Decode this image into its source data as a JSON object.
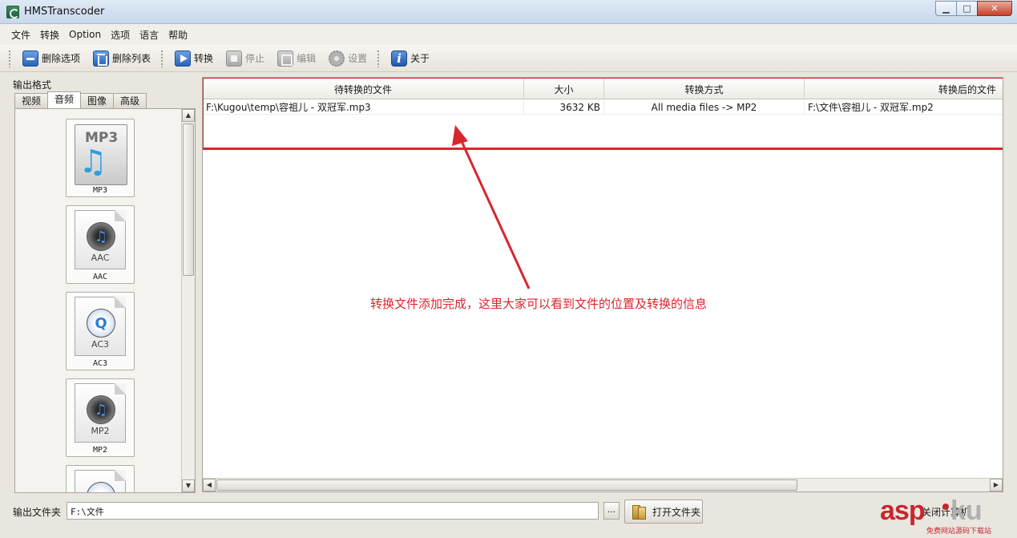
{
  "window": {
    "title": "HMSTranscoder",
    "min": "0",
    "max": "1",
    "close": "x"
  },
  "menu": [
    "文件",
    "转换",
    "Option",
    "选项",
    "语言",
    "帮助"
  ],
  "toolbar": {
    "delete_item": "删除选项",
    "delete_list": "删除列表",
    "convert": "转换",
    "stop": "停止",
    "edit": "编辑",
    "settings": "设置",
    "about": "关于"
  },
  "left_panel": {
    "label": "输出格式",
    "tabs": [
      "视频",
      "音频",
      "图像",
      "高级"
    ],
    "active_tab": "音频",
    "formats": [
      {
        "name": "MP3",
        "doc_label": "MP3"
      },
      {
        "name": "AAC",
        "doc_label": "AAC"
      },
      {
        "name": "AC3",
        "doc_label": "AC3"
      },
      {
        "name": "MP2",
        "doc_label": "MP2"
      }
    ]
  },
  "table": {
    "columns": [
      "待转换的文件",
      "大小",
      "转换方式",
      "转换后的文件"
    ],
    "rows": [
      {
        "source": "F:\\Kugou\\temp\\容祖儿 - 双冠军.mp3",
        "size": "3632 KB",
        "method": "All media files -> MP2",
        "target": "F:\\文件\\容祖儿 - 双冠军.mp2"
      }
    ]
  },
  "annotation": {
    "text": "转换文件添加完成，这里大家可以看到文件的位置及转换的信息",
    "color": "#d9262c"
  },
  "bottom": {
    "output_folder_label": "输出文件夹",
    "output_folder_value": "F:\\文件",
    "browse": "...",
    "open_folder": "打开文件夹",
    "shutdown_label": "关闭计算机"
  },
  "watermark": {
    "asp": "asp",
    "ku": "ku",
    "sub": "免费网站源码下载站"
  },
  "colors": {
    "highlight": "#d9262c",
    "accent": "#2a63b8"
  }
}
